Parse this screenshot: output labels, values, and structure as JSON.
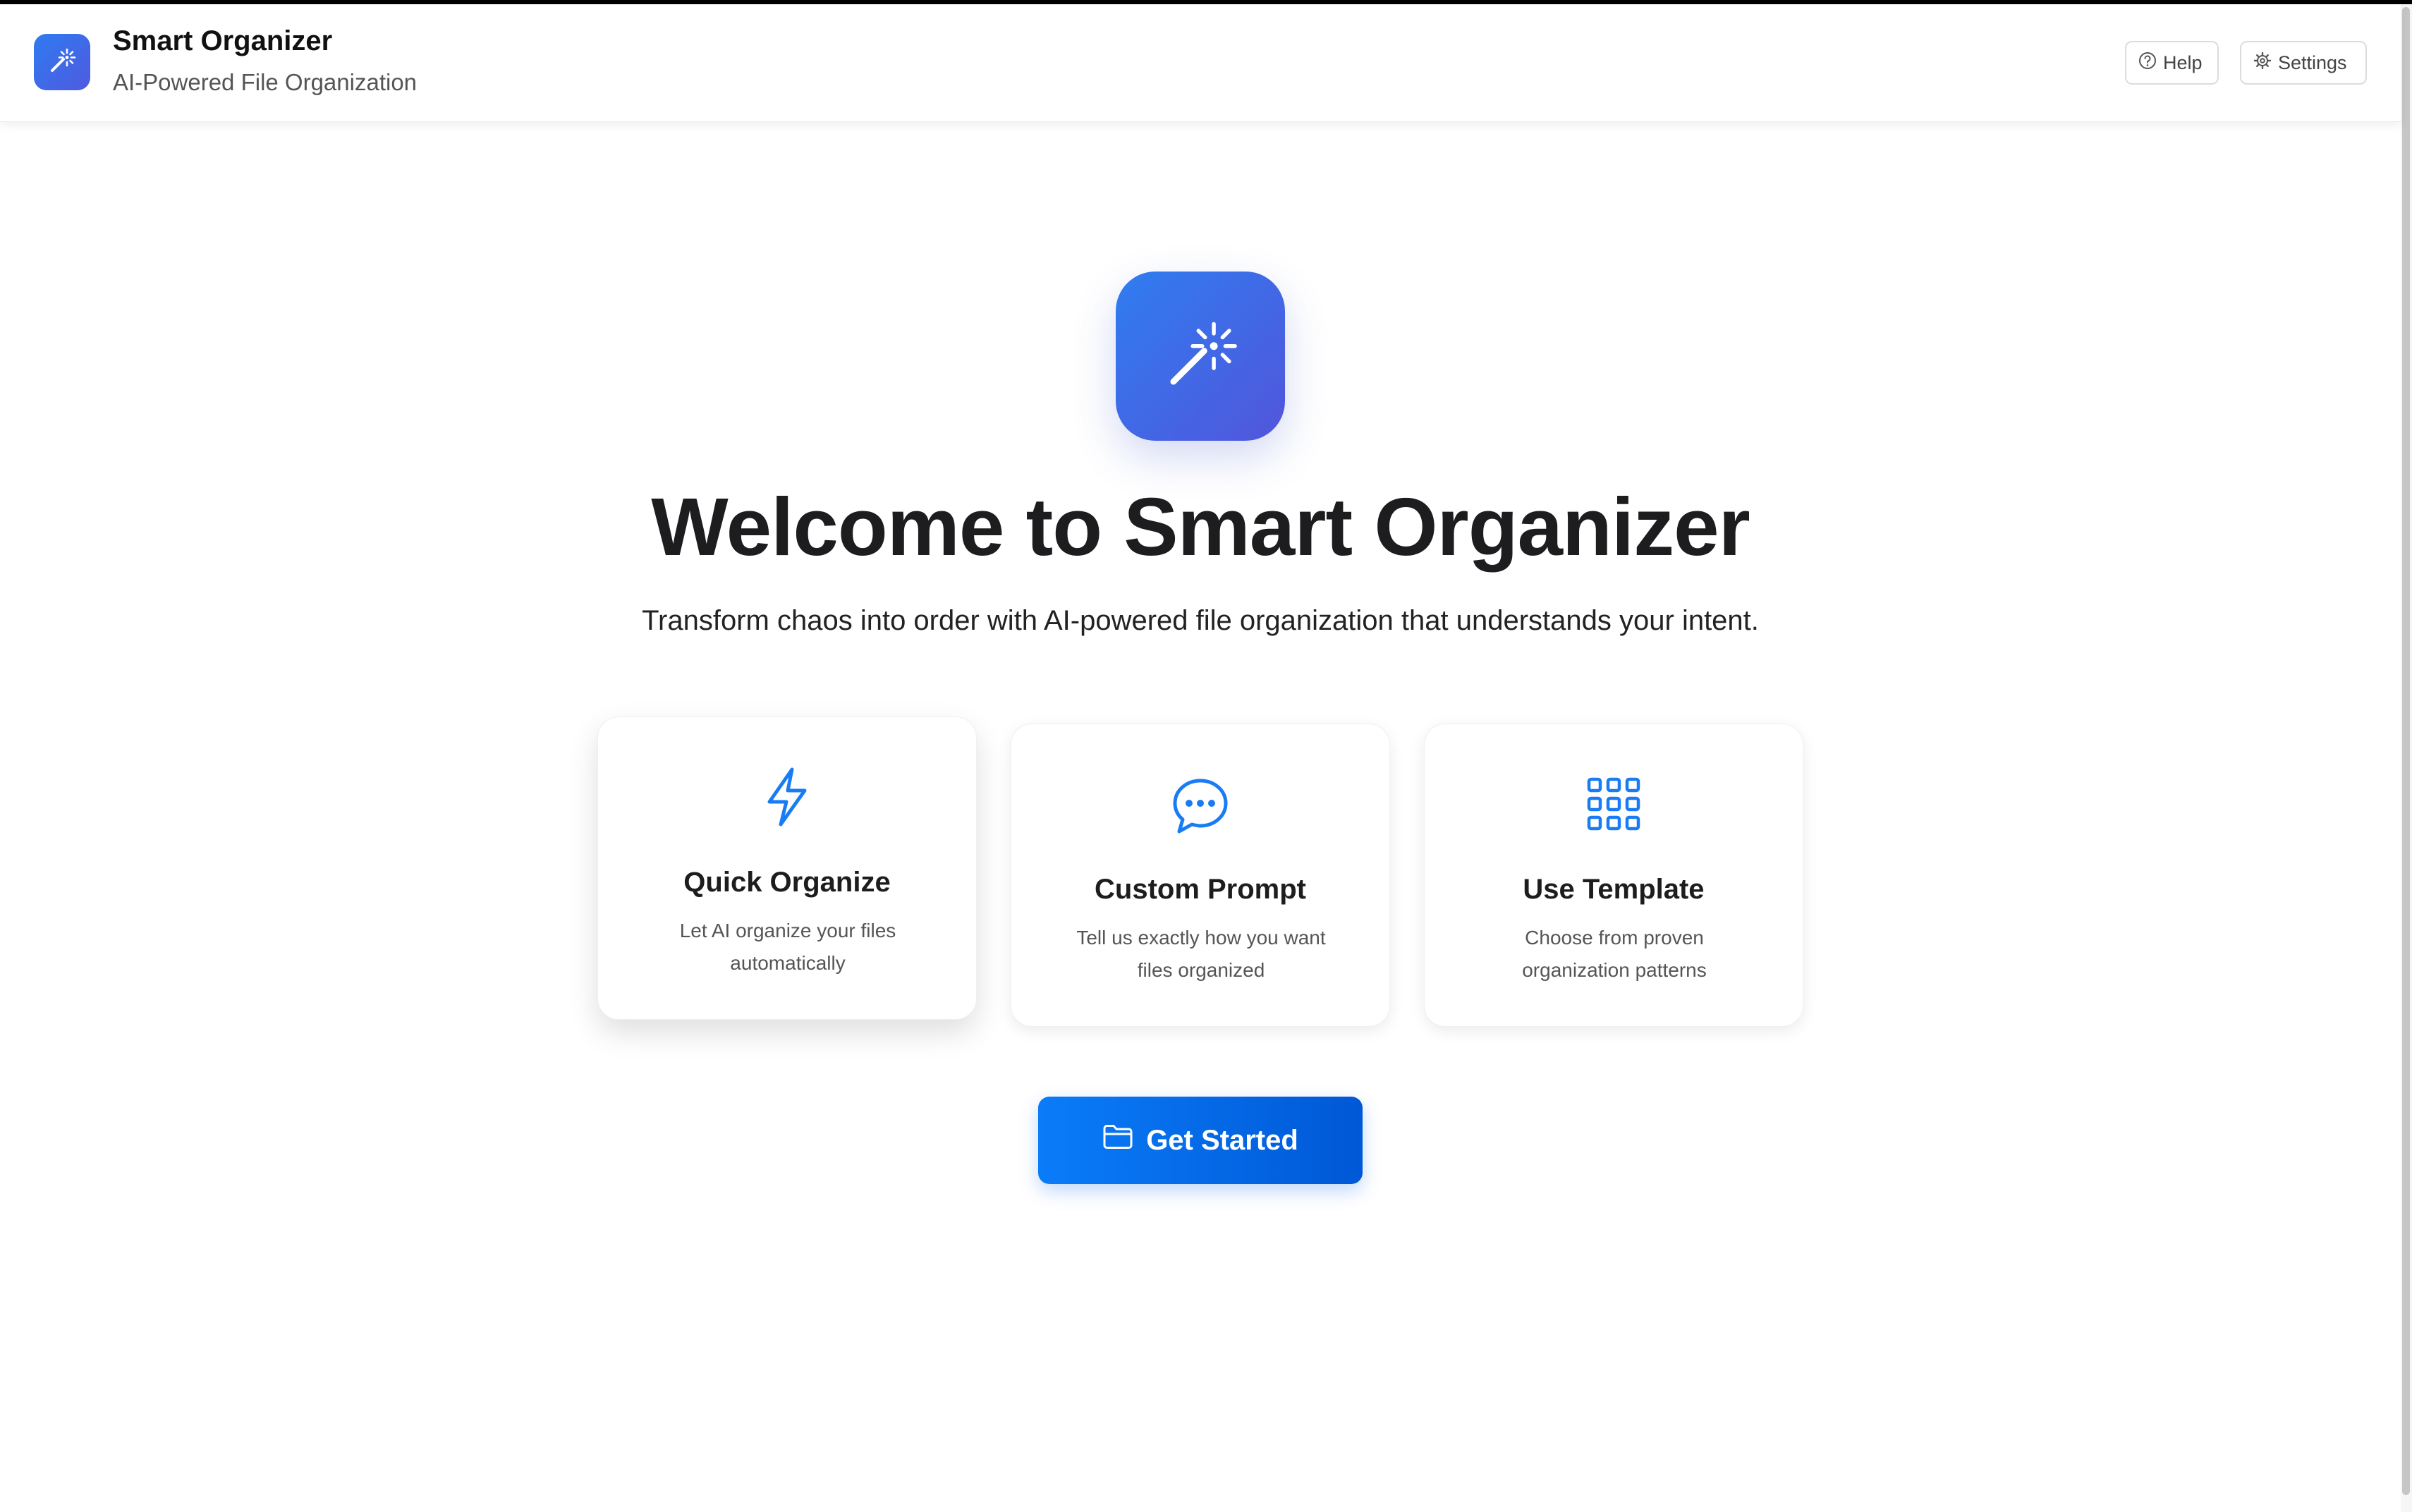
{
  "app": {
    "title": "Smart Organizer",
    "subtitle": "AI-Powered File Organization",
    "icon": "magic-wand-icon"
  },
  "header": {
    "help_label": "Help",
    "help_icon": "question-circle-icon",
    "settings_label": "Settings",
    "settings_icon": "gear-icon"
  },
  "hero": {
    "icon": "magic-wand-icon",
    "title": "Welcome to Smart Organizer",
    "subtitle": "Transform chaos into order with AI-powered file organization that understands your intent."
  },
  "cards": [
    {
      "icon": "lightning-bolt-icon",
      "title": "Quick Organize",
      "description": "Let AI organize your files automatically"
    },
    {
      "icon": "chat-bubble-icon",
      "title": "Custom Prompt",
      "description": "Tell us exactly how you want files organized"
    },
    {
      "icon": "grid-icon",
      "title": "Use Template",
      "description": "Choose from proven organization patterns"
    }
  ],
  "cta": {
    "label": "Get Started",
    "icon": "folder-icon"
  },
  "colors": {
    "accent": "#0a7cf8",
    "accent_dark": "#0058d6",
    "icon_gradient_start": "#2f7df0",
    "icon_gradient_end": "#5255dc",
    "text_primary": "#1d1d1f",
    "text_secondary": "#555555"
  }
}
